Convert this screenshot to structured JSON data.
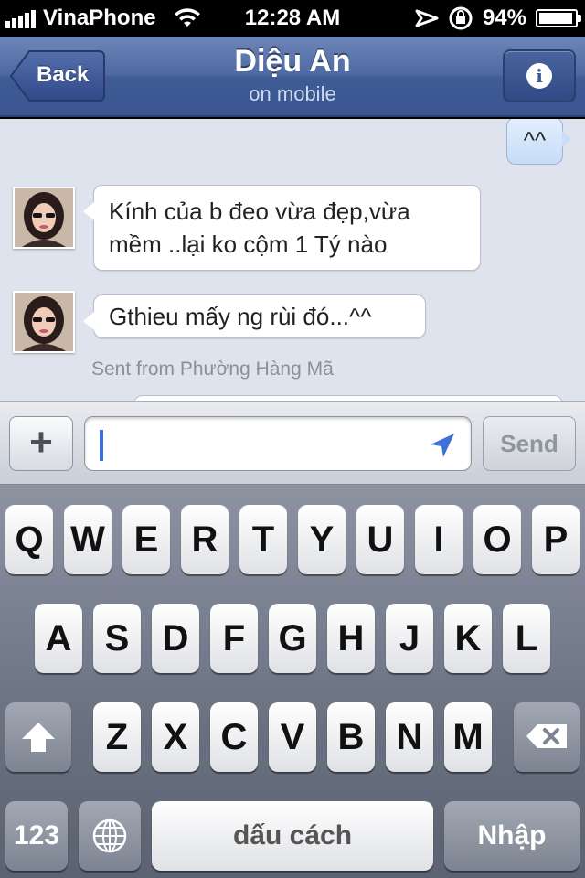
{
  "status_bar": {
    "carrier": "VinaPhone",
    "time": "12:28 AM",
    "battery": "94%",
    "battery_level": 0.94,
    "icons": [
      "signal-icon",
      "wifi-icon",
      "location-arrow-icon",
      "rotation-lock-icon",
      "battery-icon"
    ]
  },
  "nav": {
    "back_label": "Back",
    "title": "Diệu An",
    "subtitle": "on mobile",
    "info_glyph": "i",
    "colors": {
      "bar": "#4e6aa3"
    }
  },
  "messages": [
    {
      "direction": "out",
      "text": "^^"
    },
    {
      "direction": "in",
      "text_line1": "Kính của b đeo vừa đẹp,vừa",
      "text_line2": "mềm ..lại ko cộm 1 Tý nào"
    },
    {
      "direction": "in",
      "text": "Gthieu mấy ng rùi đó...^^"
    }
  ],
  "sent_from": "Sent from Phường Hàng Mã",
  "composer": {
    "plus_label": "+",
    "input_value": "",
    "send_label": "Send"
  },
  "keyboard": {
    "row1": [
      "Q",
      "W",
      "E",
      "R",
      "T",
      "Y",
      "U",
      "I",
      "O",
      "P"
    ],
    "row2": [
      "A",
      "S",
      "D",
      "F",
      "G",
      "H",
      "J",
      "K",
      "L"
    ],
    "row3": [
      "Z",
      "X",
      "C",
      "V",
      "B",
      "N",
      "M"
    ],
    "numbers_label": "123",
    "space_label": "dấu cách",
    "return_label": "Nhập"
  }
}
